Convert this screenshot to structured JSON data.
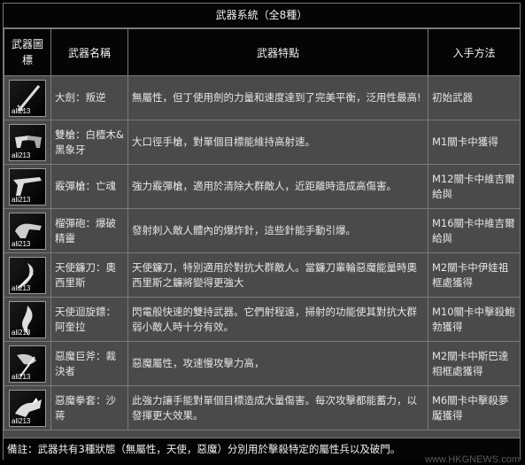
{
  "title": "武器系統（全8種）",
  "headers": {
    "icon": "武器圖標",
    "name": "武器名稱",
    "feature": "武器特點",
    "method": "入手方法"
  },
  "icon_watermark": "ali213",
  "weapons": [
    {
      "icon": "sword-icon",
      "name": "大劍：叛逆",
      "feature": "無屬性，但丁使用劍的力量和速度達到了完美平衡，泛用性最高!",
      "method": "初始武器"
    },
    {
      "icon": "twin-pistols-icon",
      "name": "雙槍：白檀木&黑象牙",
      "feature": "大口徑手槍，對單個目標能維持高射速。",
      "method": "M1關卡中獲得"
    },
    {
      "icon": "shotgun-icon",
      "name": "霰彈槍：亡魂",
      "feature": "強力霰彈槍，適用於清除大群敵人，近距離時造成高傷害。",
      "method": "M12關卡中維吉爾給與"
    },
    {
      "icon": "grenade-launcher-icon",
      "name": "榴彈砲：爆破精靈",
      "feature": "發射刺入敵人體內的爆炸針，這些針能手動引爆。",
      "method": "M16關卡中維吉爾給與"
    },
    {
      "icon": "scythe-icon",
      "name": "天使鐮刀：奧西里斯",
      "feature": "天使鐮刀，特別適用於對抗大群敵人。當鐮刀輩輪惡魔能量時奧西里斯之鐮將變得更強大",
      "method": "M2關卡中伊娃祖框處獲得"
    },
    {
      "icon": "glaives-icon",
      "name": "天使迴旋鏢：阿奎拉",
      "feature": "閃電般快速的雙持武器。它們射程遠，掃射的功能使其對抗大群弱小敵人時十分有效。",
      "method": "M10關卡中擊殺鮑勃獲得"
    },
    {
      "icon": "axe-icon",
      "name": "惡魔巨斧：裁決者",
      "feature": "惡魔屬性，攻速慢攻擊力高，",
      "method": "M2關卡中斯巴達相框處獲得"
    },
    {
      "icon": "gauntlets-icon",
      "name": "惡魔拳套：沙蒋",
      "feature": "此強力讓手能對單個目標造成大量傷害。每次攻擊都能蓄力，以發揮更大效果。",
      "method": "M6關卡中擊殺夢魘獲得"
    }
  ],
  "footer": "備註：武器共有3種狀態（無屬性，天使，惡魔）分別用於擊殺特定的屬性兵以及破門。",
  "watermark": "www.HKGNEWS.com"
}
